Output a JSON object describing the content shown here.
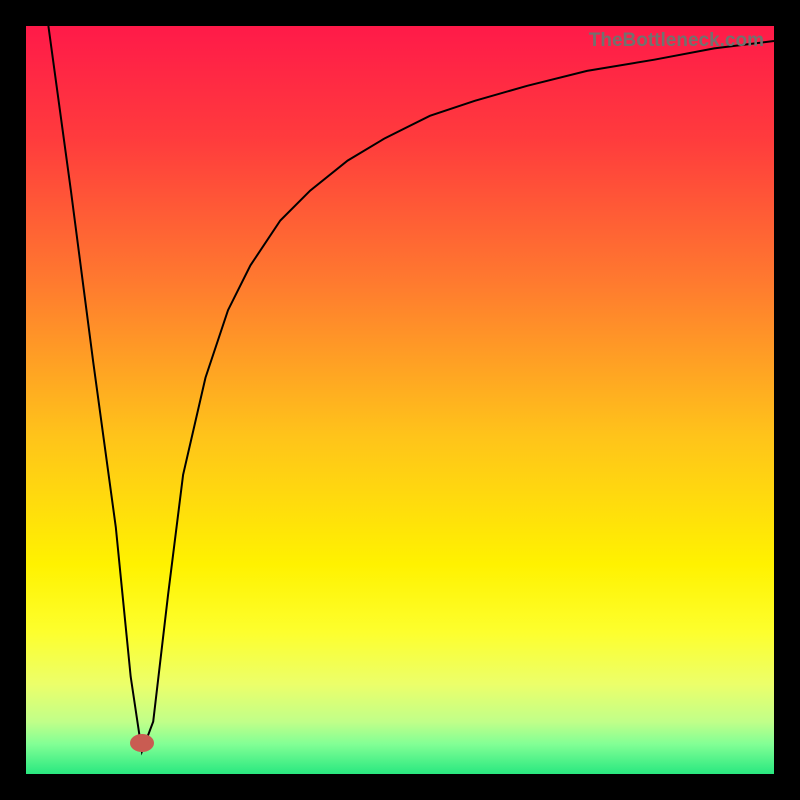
{
  "attribution": "TheBottleneck.com",
  "marker": {
    "cx": 116,
    "cy": 717,
    "rx": 12,
    "ry": 9
  },
  "gradient_stops": [
    {
      "pct": 0,
      "color": "#ff1a49"
    },
    {
      "pct": 15,
      "color": "#ff3b3d"
    },
    {
      "pct": 34,
      "color": "#ff792f"
    },
    {
      "pct": 55,
      "color": "#ffc41a"
    },
    {
      "pct": 72,
      "color": "#fff200"
    },
    {
      "pct": 81,
      "color": "#fdff2d"
    },
    {
      "pct": 88,
      "color": "#ecff6a"
    },
    {
      "pct": 93,
      "color": "#c1ff89"
    },
    {
      "pct": 96,
      "color": "#82ff95"
    },
    {
      "pct": 100,
      "color": "#29e880"
    }
  ],
  "chart_data": {
    "type": "line",
    "title": "",
    "xlabel": "",
    "ylabel": "",
    "ylim": [
      0,
      100
    ],
    "xlim": [
      0,
      100
    ],
    "x": [
      3,
      6,
      9,
      12,
      14,
      15.5,
      17,
      19,
      21,
      24,
      27,
      30,
      34,
      38,
      43,
      48,
      54,
      60,
      67,
      75,
      84,
      92,
      100
    ],
    "values": [
      100,
      78,
      55,
      33,
      13,
      3,
      7,
      24,
      40,
      53,
      62,
      68,
      74,
      78,
      82,
      85,
      88,
      90,
      92,
      94,
      95.5,
      97,
      98
    ]
  }
}
